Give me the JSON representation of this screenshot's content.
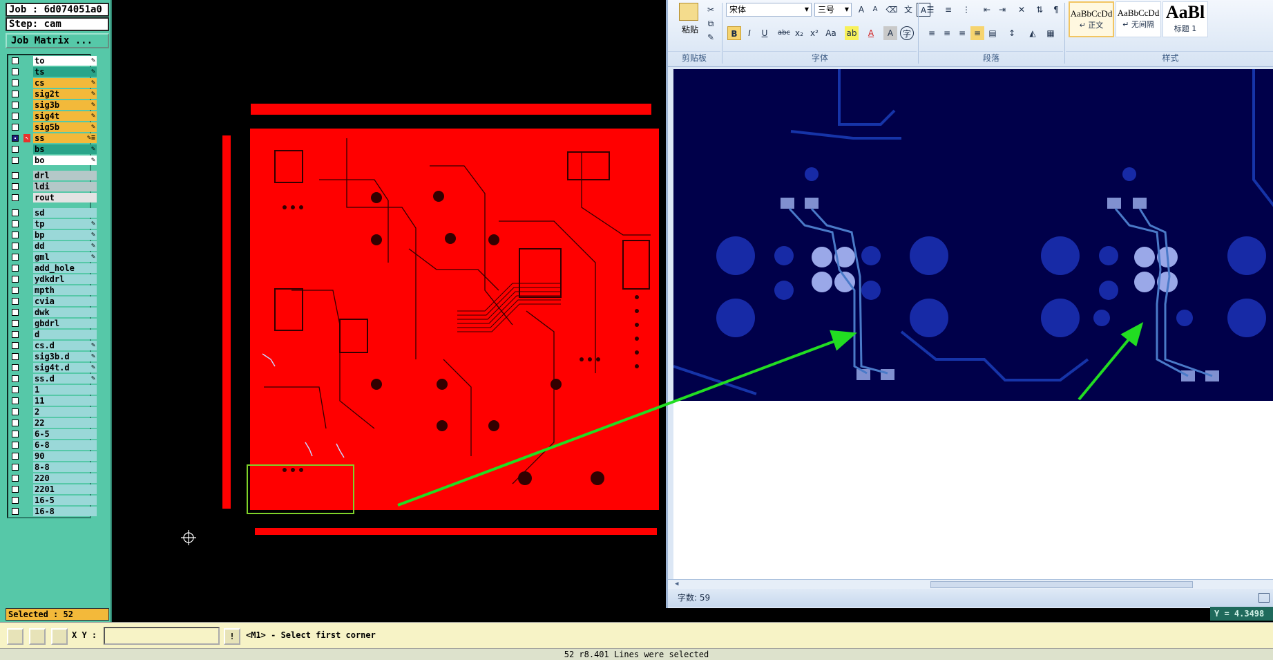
{
  "cam": {
    "job": "Job : 6d074051a0",
    "step": "Step: cam",
    "job_matrix_label": "Job Matrix ...",
    "selected": "Selected : 52",
    "layers": [
      {
        "name": "to",
        "color": "#ffffff",
        "tag": "✎",
        "group": 1
      },
      {
        "name": "ts",
        "color": "#2aa58a",
        "tag": "✎",
        "group": 1
      },
      {
        "name": "cs",
        "color": "#f3b93a",
        "tag": "✎",
        "group": 1
      },
      {
        "name": "sig2t",
        "color": "#f3b93a",
        "tag": "✎",
        "group": 1
      },
      {
        "name": "sig3b",
        "color": "#f3b93a",
        "tag": "✎",
        "group": 1
      },
      {
        "name": "sig4t",
        "color": "#f3b93a",
        "tag": "✎",
        "group": 1
      },
      {
        "name": "sig5b",
        "color": "#f3b93a",
        "tag": "✎",
        "group": 1
      },
      {
        "name": "ss",
        "color": "#f3b93a",
        "tag": "✎≡",
        "group": 1,
        "active": true
      },
      {
        "name": "bs",
        "color": "#2aa58a",
        "tag": "✎",
        "group": 1
      },
      {
        "name": "bo",
        "color": "#ffffff",
        "tag": "✎",
        "group": 1
      },
      {
        "name": "drl",
        "color": "#b4c8c8",
        "tag": "",
        "group": 2
      },
      {
        "name": "ldi",
        "color": "#b4c8c8",
        "tag": "",
        "group": 2
      },
      {
        "name": "rout",
        "color": "#e3e3e3",
        "tag": "",
        "group": 2
      },
      {
        "name": "sd",
        "color": "#9ad8d8",
        "tag": "",
        "group": 3
      },
      {
        "name": "tp",
        "color": "#9ad8d8",
        "tag": "✎",
        "group": 3
      },
      {
        "name": "bp",
        "color": "#9ad8d8",
        "tag": "✎",
        "group": 3
      },
      {
        "name": "dd",
        "color": "#9ad8d8",
        "tag": "✎",
        "group": 3
      },
      {
        "name": "gml",
        "color": "#9ad8d8",
        "tag": "✎",
        "group": 3
      },
      {
        "name": "add_hole",
        "color": "#9ad8d8",
        "tag": "",
        "group": 3
      },
      {
        "name": "ydkdrl",
        "color": "#9ad8d8",
        "tag": "",
        "group": 3
      },
      {
        "name": "mpth",
        "color": "#9ad8d8",
        "tag": "",
        "group": 3
      },
      {
        "name": "cvia",
        "color": "#9ad8d8",
        "tag": "",
        "group": 3
      },
      {
        "name": "dwk",
        "color": "#9ad8d8",
        "tag": "",
        "group": 3
      },
      {
        "name": "gbdrl",
        "color": "#9ad8d8",
        "tag": "",
        "group": 3
      },
      {
        "name": "d",
        "color": "#9ad8d8",
        "tag": "",
        "group": 3
      },
      {
        "name": "cs.d",
        "color": "#9ad8d8",
        "tag": "✎",
        "group": 3
      },
      {
        "name": "sig3b.d",
        "color": "#9ad8d8",
        "tag": "✎",
        "group": 3
      },
      {
        "name": "sig4t.d",
        "color": "#9ad8d8",
        "tag": "✎",
        "group": 3
      },
      {
        "name": "ss.d",
        "color": "#9ad8d8",
        "tag": "✎",
        "group": 3
      },
      {
        "name": "1",
        "color": "#9ad8d8",
        "tag": "",
        "group": 3
      },
      {
        "name": "11",
        "color": "#9ad8d8",
        "tag": "",
        "group": 3
      },
      {
        "name": "2",
        "color": "#9ad8d8",
        "tag": "",
        "group": 3
      },
      {
        "name": "22",
        "color": "#9ad8d8",
        "tag": "",
        "group": 3
      },
      {
        "name": "6-5",
        "color": "#9ad8d8",
        "tag": "",
        "group": 3
      },
      {
        "name": "6-8",
        "color": "#9ad8d8",
        "tag": "",
        "group": 3
      },
      {
        "name": "90",
        "color": "#9ad8d8",
        "tag": "",
        "group": 3
      },
      {
        "name": "8-8",
        "color": "#9ad8d8",
        "tag": "",
        "group": 3
      },
      {
        "name": "220",
        "color": "#9ad8d8",
        "tag": "",
        "group": 3
      },
      {
        "name": "2201",
        "color": "#9ad8d8",
        "tag": "",
        "group": 3
      },
      {
        "name": "16-5",
        "color": "#9ad8d8",
        "tag": "",
        "group": 3
      },
      {
        "name": "16-8",
        "color": "#9ad8d8",
        "tag": "",
        "group": 3
      }
    ]
  },
  "word": {
    "paste_label": "粘贴",
    "font_name": "宋体",
    "font_size": "三号",
    "groups": {
      "clipboard": "剪贴板",
      "font": "字体",
      "paragraph": "段落",
      "styles": "样式"
    },
    "styles": [
      {
        "sample": "AaBbCcDd",
        "label": "↵ 正文"
      },
      {
        "sample": "AaBbCcDd",
        "label": "↵ 无间隔"
      },
      {
        "sample": "AaBl",
        "label": "标题 1"
      }
    ],
    "word_count": "字数: 59"
  },
  "coord_readout": "Y = 4.3498",
  "command": {
    "xy_label": "X Y :",
    "xy_value": "",
    "info_label": "!",
    "prompt": "<M1> - Select first corner"
  },
  "status": "52 r8.401 Lines were selected",
  "colors": {
    "board": "#ff0000",
    "annotation": "#22dd22",
    "highlight_box": "#7fd32a",
    "word_bg": "#00004a"
  }
}
